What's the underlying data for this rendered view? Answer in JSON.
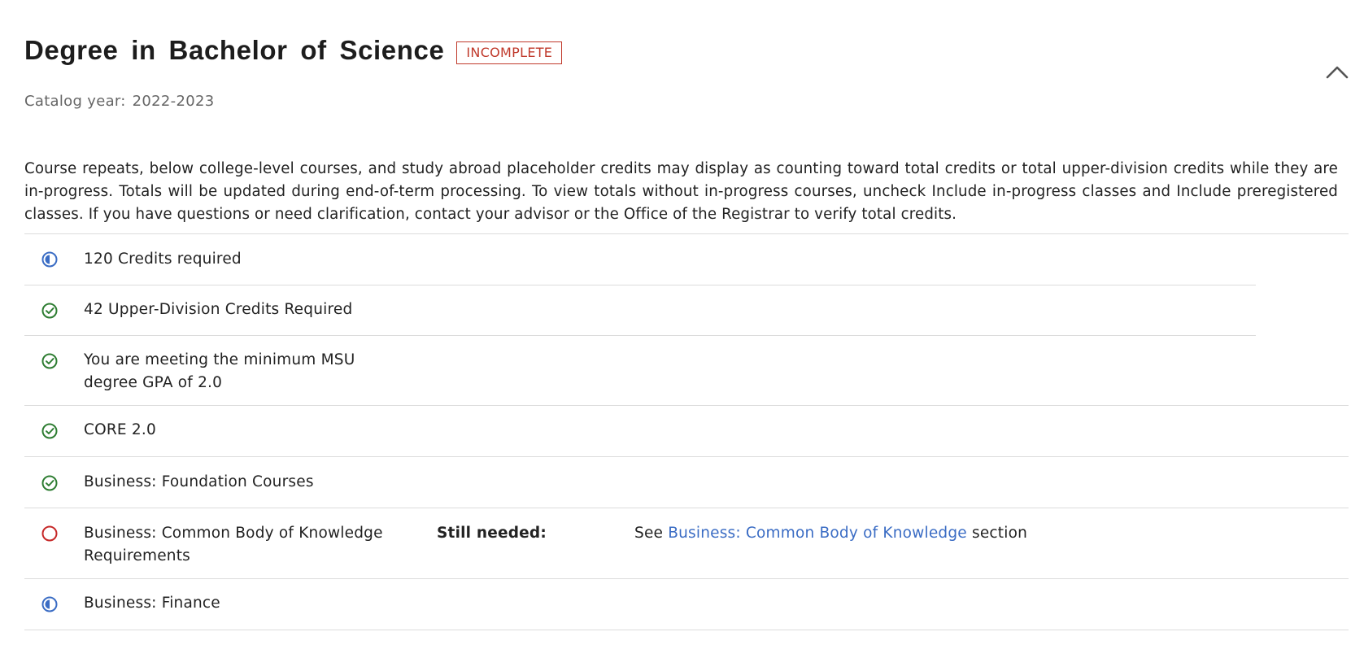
{
  "header": {
    "title": "Degree in Bachelor of Science",
    "status_badge": "INCOMPLETE"
  },
  "catalog": {
    "label": "Catalog year:",
    "value": "2022-2023"
  },
  "notice": "Course repeats, below college-level courses, and study abroad placeholder credits may display as counting toward total credits or total upper-division credits while they are in-progress. Totals will be updated during end-of-term processing. To view totals without in-progress courses, uncheck Include in-progress classes and Include preregistered classes. If you have questions or need clarification, contact your advisor or the Office of the Registrar to verify total credits.",
  "requirements": [
    {
      "label": "120 Credits required",
      "status": "in-progress"
    },
    {
      "label": "42 Upper-Division Credits Required",
      "status": "complete"
    },
    {
      "label": "You are meeting the minimum MSU degree GPA of 2.0",
      "status": "complete"
    },
    {
      "label": "CORE 2.0",
      "status": "complete"
    },
    {
      "label": "Business: Foundation Courses",
      "status": "complete"
    },
    {
      "label": "Business: Common Body of Knowledge Requirements",
      "status": "not-started",
      "still_needed_label": "Still needed:",
      "see_prefix": "See",
      "see_link": "Business: Common Body of Knowledge",
      "see_suffix": "section"
    },
    {
      "label": "Business: Finance",
      "status": "in-progress"
    }
  ],
  "colors": {
    "in_progress": "#3a6cc4",
    "complete": "#2e7d32",
    "not_started": "#c62828",
    "badge": "#c0392b",
    "link": "#3a6cc4"
  },
  "icons": {
    "in-progress": "half-circle-icon",
    "complete": "check-circle-icon",
    "not-started": "empty-circle-icon",
    "collapse": "chevron-up-icon"
  }
}
